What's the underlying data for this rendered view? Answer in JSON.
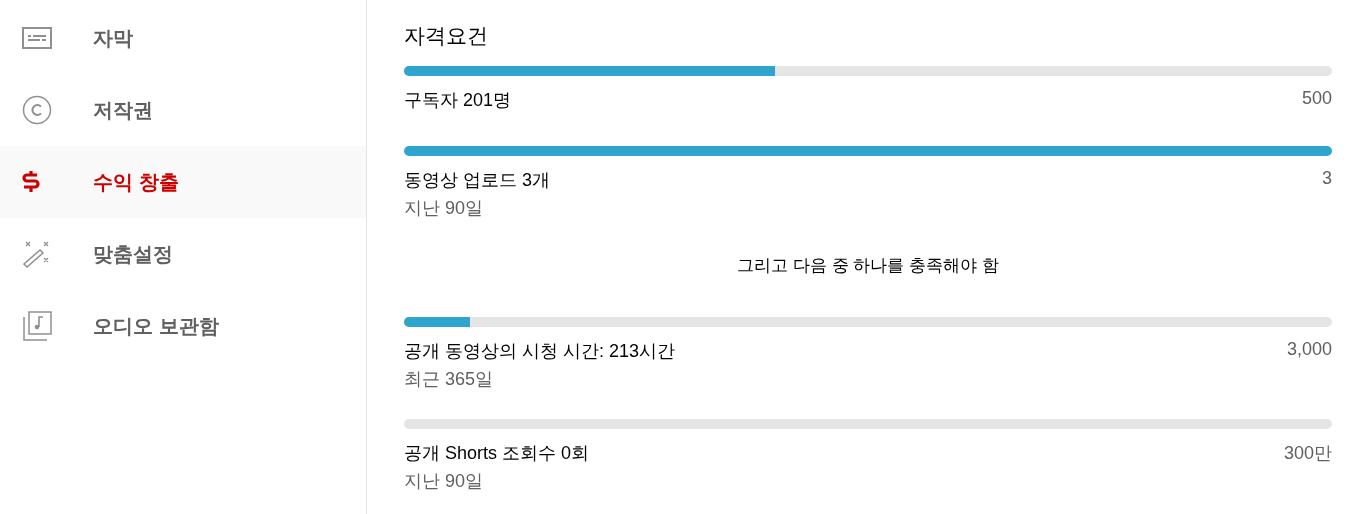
{
  "sidebar": {
    "items": [
      {
        "label": "자막",
        "selected": false
      },
      {
        "label": "저작권",
        "selected": false
      },
      {
        "label": "수익 창출",
        "selected": true
      },
      {
        "label": "맞춤설정",
        "selected": false
      },
      {
        "label": "오디오 보관함",
        "selected": false
      }
    ]
  },
  "eligibility": {
    "title": "자격요건",
    "requirements": [
      {
        "label": "구독자 201명",
        "target": "500",
        "level": 0.4
      },
      {
        "label": "동영상 업로드 3개",
        "sub": "지난 90일",
        "target": "3",
        "level": 1
      }
    ],
    "note": "그리고 다음 중 하나를 충족해야 함",
    "options": [
      {
        "label": "공개 동영상의 시청 시간: 213시간",
        "sub": "최근 365일",
        "target": "3,000",
        "level": 0.071
      },
      {
        "label": "공개 Shorts 조회수 0회",
        "sub": "지난 90일",
        "target": "300만",
        "level": 0
      }
    ]
  }
}
